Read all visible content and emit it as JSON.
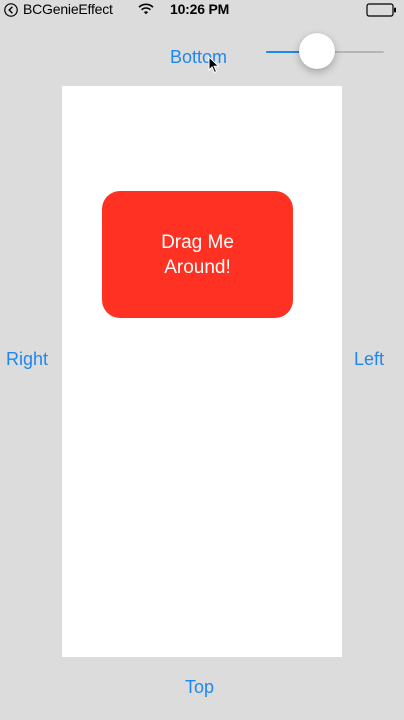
{
  "status_bar": {
    "back_app": "BCGenieEffect",
    "time": "10:26 PM",
    "icons": [
      "back-chevron-icon",
      "wifi-icon",
      "battery-icon"
    ]
  },
  "labels": {
    "bottom": "Bottom",
    "right": "Right",
    "left": "Left",
    "top": "Top"
  },
  "slider": {
    "value": 0.4
  },
  "drag_box": {
    "label": "Drag Me Around!"
  },
  "colors": {
    "background": "#dcdcdc",
    "container": "#ffffff",
    "accent": "#1e87f0",
    "drag_box": "#ff3122",
    "track": "#b6b6b6"
  }
}
